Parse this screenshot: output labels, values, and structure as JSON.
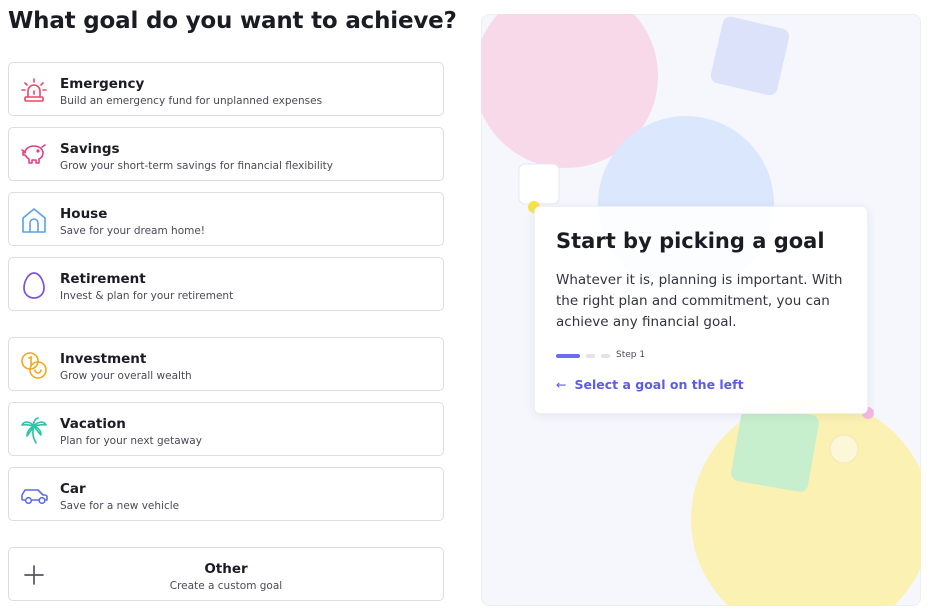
{
  "page_title": "What goal do you want to achieve?",
  "goals": [
    {
      "id": "emergency",
      "title": "Emergency",
      "description": "Build an emergency fund for unplanned expenses",
      "icon": "siren-icon",
      "color": "#e8476a"
    },
    {
      "id": "savings",
      "title": "Savings",
      "description": "Grow your short-term savings for financial flexibility",
      "icon": "piggy-bank-icon",
      "color": "#e23e82"
    },
    {
      "id": "house",
      "title": "House",
      "description": "Save for your dream home!",
      "icon": "house-icon",
      "color": "#5aa0e6"
    },
    {
      "id": "retirement",
      "title": "Retirement",
      "description": "Invest & plan for your retirement",
      "icon": "egg-icon",
      "color": "#7b4fe0"
    },
    {
      "id": "investment",
      "title": "Investment",
      "description": "Grow your overall wealth",
      "icon": "coins-icon",
      "color": "#f0a81c"
    },
    {
      "id": "vacation",
      "title": "Vacation",
      "description": "Plan for your next getaway",
      "icon": "palm-tree-icon",
      "color": "#2bc4a8"
    },
    {
      "id": "car",
      "title": "Car",
      "description": "Save for a new vehicle",
      "icon": "car-icon",
      "color": "#5b6bea"
    }
  ],
  "other": {
    "title": "Other",
    "description": "Create a custom goal",
    "icon": "plus-icon",
    "color": "#55555f"
  },
  "info": {
    "title": "Start by picking a goal",
    "body": "Whatever it is, planning is important. With the right plan and commitment, you can achieve any financial goal.",
    "step_label": "Step 1",
    "link_text": "Select a goal on the left",
    "link_arrow": "←",
    "accent_color": "#6b6bf0"
  }
}
